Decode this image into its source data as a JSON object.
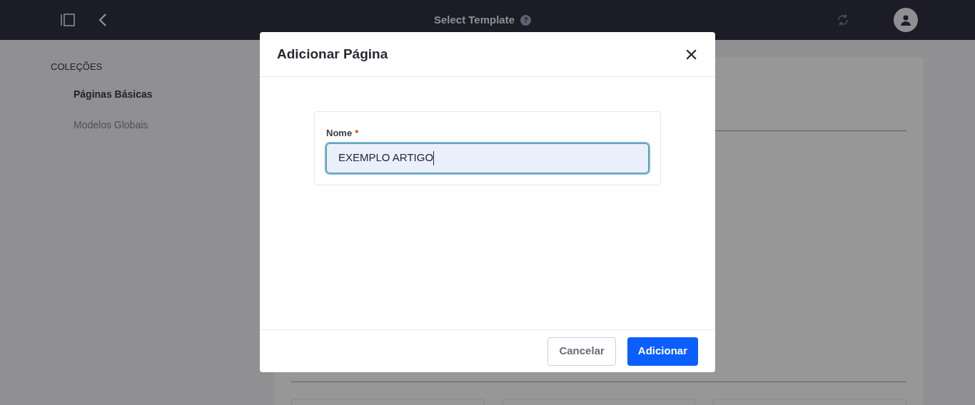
{
  "top_bar": {
    "title": "Select Template",
    "help": "?"
  },
  "sidebar": {
    "heading": "COLEÇÕES",
    "items": [
      {
        "label": "Páginas Básicas",
        "selected": true
      },
      {
        "label": "Modelos Globais",
        "selected": false
      }
    ]
  },
  "modal": {
    "title": "Adicionar Página",
    "close": "×",
    "field": {
      "label": "Nome",
      "required": true,
      "required_mark": "*",
      "value": "EXEMPLO ARTIGO",
      "focused": true
    },
    "buttons": [
      {
        "label": "Cancelar",
        "kind": "secondary"
      },
      {
        "label": "Adicionar",
        "kind": "primary"
      }
    ]
  }
}
